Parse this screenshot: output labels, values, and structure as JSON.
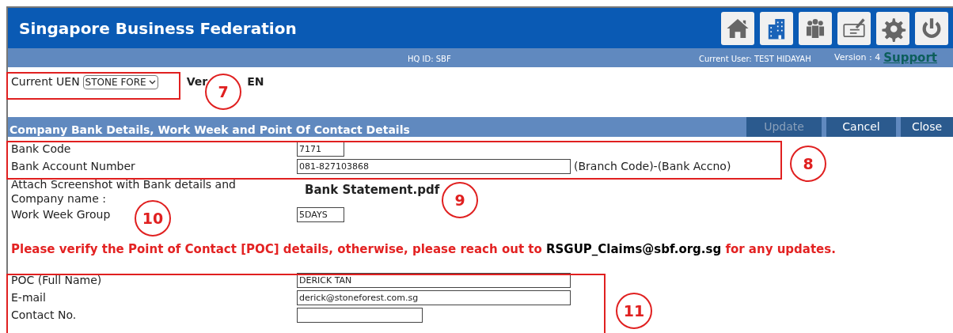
{
  "header": {
    "title": "Singapore Business Federation",
    "toolbar": [
      {
        "kind": "home"
      },
      {
        "kind": "building"
      },
      {
        "kind": "people"
      },
      {
        "kind": "cheque"
      },
      {
        "kind": "settings"
      },
      {
        "kind": "power"
      }
    ]
  },
  "subbar": {
    "hq_id": "HQ ID: SBF",
    "user": "Current User: TEST HIDAYAH",
    "version": "Version : 4",
    "support_link": "Support"
  },
  "uen": {
    "label": "Current UEN",
    "value": "STONE FORE",
    "version_text_parts": [
      "Ver",
      "EN"
    ]
  },
  "section": {
    "title": "Company Bank Details, Work Week and Point Of Contact Details",
    "buttons": [
      {
        "label": "Update",
        "disabled": true
      },
      {
        "label": "Cancel",
        "disabled": false
      },
      {
        "label": "Close",
        "disabled": false
      }
    ]
  },
  "bank_fields": [
    {
      "label": "Bank Code",
      "value": "7171",
      "kind": "short"
    },
    {
      "label": "Bank Account Number",
      "value": "081-827103868",
      "kind": "long",
      "hint": "(Branch Code)-(Bank Accno)"
    }
  ],
  "attachment": {
    "label": "Attach Screenshot with Bank details and Company name :",
    "file": "Bank Statement.pdf"
  },
  "work_week": {
    "label": "Work Week Group",
    "value": "5DAYS"
  },
  "notice": {
    "before": "Please verify the Point of Contact [POC] details, otherwise, please reach out to",
    "email": "RSGUP_Claims@sbf.org.sg",
    "after": "for any updates."
  },
  "poc_fields": [
    {
      "label": "POC (Full Name)",
      "value": "DERICK TAN",
      "kind": "long"
    },
    {
      "label": "E-mail",
      "value": "derick@stoneforest.com.sg",
      "kind": "long"
    },
    {
      "label": "Contact No.",
      "kind": "medium"
    }
  ],
  "annotations": [
    "7",
    "8",
    "9",
    "10",
    "11"
  ]
}
